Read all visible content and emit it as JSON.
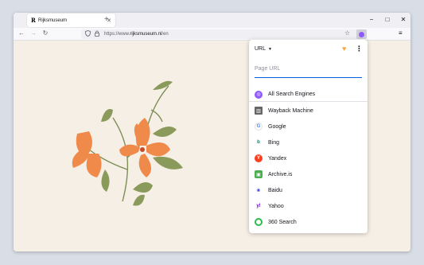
{
  "tab": {
    "favicon": "R",
    "title": "Rijksmuseum",
    "close": "✕",
    "new": "+"
  },
  "window_controls": {
    "minimize": "−",
    "maximize": "□",
    "close": "✕"
  },
  "nav": {
    "back": "←",
    "forward": "→",
    "reload": "↻"
  },
  "urlbar": {
    "prefix": "https://www.",
    "domain": "rijksmuseum.nl",
    "path": "/en"
  },
  "toolbar": {
    "star": "☆",
    "menu": "≡"
  },
  "popup": {
    "mode": "URL",
    "url_placeholder": "Page URL",
    "all_label": "All Search Engines",
    "engines": [
      {
        "label": "Wayback Machine",
        "icon": "wayback-icon",
        "color": "#666666"
      },
      {
        "label": "Google",
        "icon": "google-icon",
        "color": "#4285f4"
      },
      {
        "label": "Bing",
        "icon": "bing-icon",
        "color": "#008373"
      },
      {
        "label": "Yandex",
        "icon": "yandex-icon",
        "color": "#fc3f1d"
      },
      {
        "label": "Archive.is",
        "icon": "archive-is-icon",
        "color": "#4caf50"
      },
      {
        "label": "Baidu",
        "icon": "baidu-icon",
        "color": "#2932e1"
      },
      {
        "label": "Yahoo",
        "icon": "yahoo-icon",
        "color": "#6001d2"
      },
      {
        "label": "360 Search",
        "icon": "360-search-icon",
        "color": "#2dba4e"
      }
    ]
  }
}
